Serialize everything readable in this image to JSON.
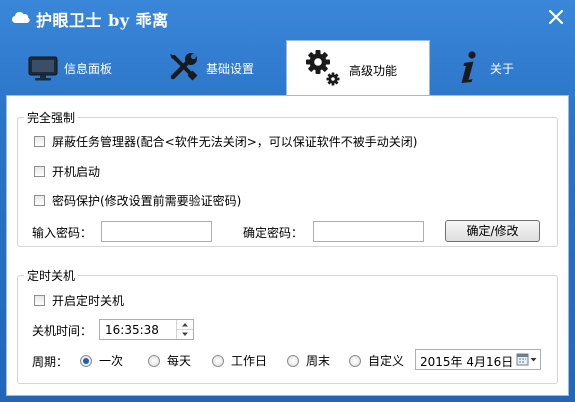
{
  "window": {
    "title": "护眼卫士 by 乖离"
  },
  "tabs": [
    {
      "label": "信息面板",
      "icon": "monitor-icon",
      "active": false
    },
    {
      "label": "基础设置",
      "icon": "tools-icon",
      "active": false
    },
    {
      "label": "高级功能",
      "icon": "gears-icon",
      "active": true
    },
    {
      "label": "关于",
      "icon": "info-icon",
      "active": false
    }
  ],
  "force": {
    "title": "完全强制",
    "hide_taskmgr": "屏蔽任务管理器(配合<软件无法关闭>，可以保证软件不被手动关闭)",
    "autostart": "开机启动",
    "password_protect": "密码保护(修改设置前需要验证密码)",
    "password_label": "输入密码：",
    "password_value": "",
    "confirm_label": "确定密码：",
    "confirm_value": "",
    "confirm_button": "确定/修改"
  },
  "shutdown": {
    "title": "定时关机",
    "enable": "开启定时关机",
    "time_label": "关机时间：",
    "time_value": "16:35:38",
    "period_label": "周期：",
    "periods": [
      {
        "label": "一次",
        "checked": true
      },
      {
        "label": "每天",
        "checked": false
      },
      {
        "label": "工作日",
        "checked": false
      },
      {
        "label": "周末",
        "checked": false
      },
      {
        "label": "自定义",
        "checked": false
      }
    ],
    "date_value": "2015年 4月16日"
  },
  "colors": {
    "titlebar": "#2a74c8",
    "radio_dot": "#1e5fb8"
  }
}
